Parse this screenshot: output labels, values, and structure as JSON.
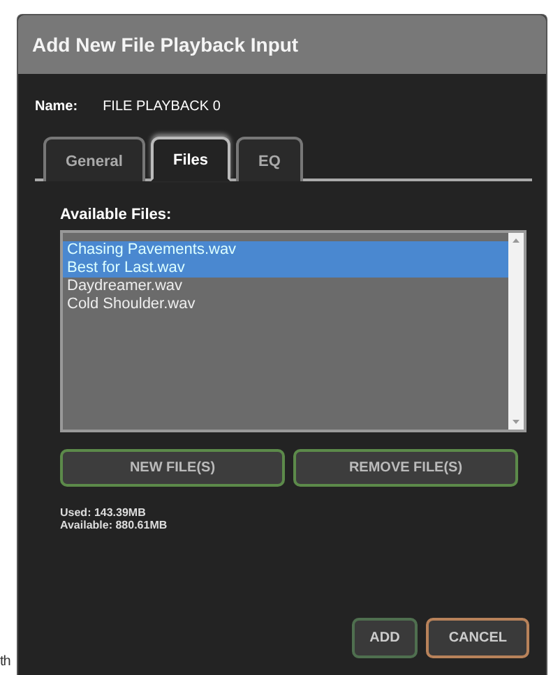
{
  "background_text": "th",
  "window": {
    "title": "Add New File Playback Input"
  },
  "name": {
    "label": "Name:",
    "value": "FILE PLAYBACK 0"
  },
  "tabs": [
    {
      "label": "General",
      "selected": false
    },
    {
      "label": "Files",
      "selected": true
    },
    {
      "label": "EQ",
      "selected": false
    }
  ],
  "files": {
    "label": "Available Files:",
    "items": [
      {
        "name": "Chasing Pavements.wav",
        "selected": true
      },
      {
        "name": "Best for Last.wav",
        "selected": true
      },
      {
        "name": "Daydreamer.wav",
        "selected": false
      },
      {
        "name": "Cold Shoulder.wav",
        "selected": false
      }
    ]
  },
  "file_buttons": [
    "NEW FILE(S)",
    "REMOVE FILE(S)"
  ],
  "storage": {
    "used": "Used: 143.39MB",
    "available": "Available: 880.61MB"
  },
  "buttons": [
    {
      "label": "ADD",
      "kind": "primary"
    },
    {
      "label": "CANCEL",
      "kind": "cancel"
    }
  ]
}
